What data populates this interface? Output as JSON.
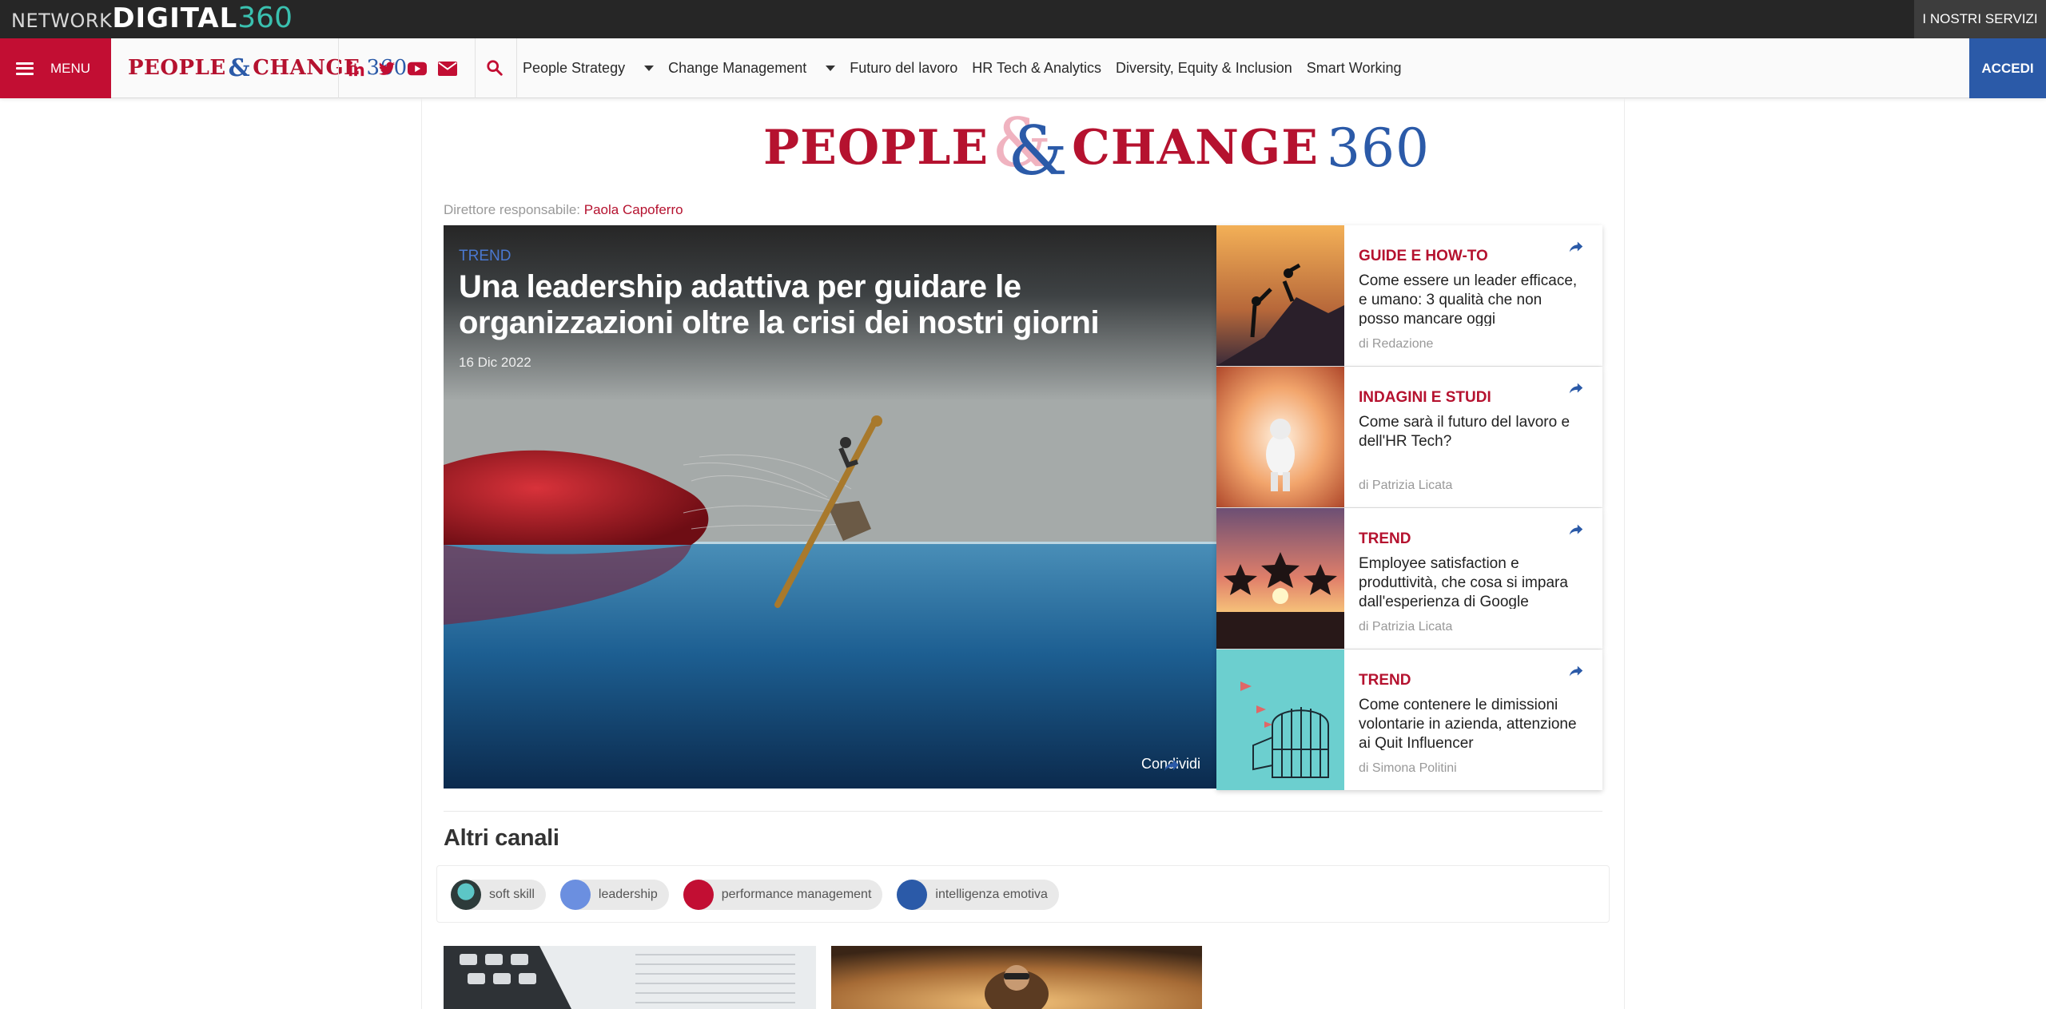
{
  "netbar": {
    "logo": {
      "part1": "NETWORK",
      "part2": "DIGITAL",
      "part3": "360"
    },
    "services_label": "I NOSTRI SERVIZI"
  },
  "nav": {
    "menu_label": "MENU",
    "logo": {
      "part1": "PEOPLE",
      "amp": "&",
      "part2": "CHANGE",
      "num": "360"
    },
    "social_icons": [
      "linkedin-icon",
      "twitter-icon",
      "youtube-icon",
      "mail-icon"
    ],
    "links": [
      {
        "label": "People Strategy",
        "has_dropdown": true
      },
      {
        "label": "Change Management",
        "has_dropdown": true
      },
      {
        "label": "Futuro del lavoro",
        "has_dropdown": false
      },
      {
        "label": "HR Tech & Analytics",
        "has_dropdown": false
      },
      {
        "label": "Diversity, Equity & Inclusion",
        "has_dropdown": false
      },
      {
        "label": "Smart Working",
        "has_dropdown": false
      }
    ],
    "login_label": "ACCEDI"
  },
  "masthead": {
    "logo": {
      "part1": "PEOPLE",
      "amp": "&",
      "part2": "CHANGE",
      "num": "360"
    },
    "director_label": "Direttore responsabile:",
    "director_name": "Paola Capoferro"
  },
  "hero": {
    "tag": "TREND",
    "title": "Una leadership adattiva per guidare le organizzazioni oltre la crisi dei nostri giorni",
    "date": "16 Dic 2022",
    "share_label": "Condividi"
  },
  "side_articles": [
    {
      "category": "GUIDE E HOW-TO",
      "title": "Come essere un leader efficace, e umano: 3 qualità che non posso mancare oggi",
      "author": "di Redazione"
    },
    {
      "category": "INDAGINI E STUDI",
      "title": "Come sarà il futuro del lavoro e dell'HR Tech?",
      "author": "di Patrizia Licata"
    },
    {
      "category": "TREND",
      "title": "Employee satisfaction e produttività, che cosa si impara dall'esperienza di Google",
      "author": "di Patrizia Licata"
    },
    {
      "category": "TREND",
      "title": "Come contenere le dimissioni volontarie in azienda, attenzione ai Quit Influencer",
      "author": "di Simona Politini"
    }
  ],
  "altri_canali": {
    "heading": "Altri canali",
    "chips": [
      {
        "label": "soft skill",
        "color": "#2d3b3a"
      },
      {
        "label": "leadership",
        "color": "#6b8fe0"
      },
      {
        "label": "performance management",
        "color": "#c20e33"
      },
      {
        "label": "intelligenza emotiva",
        "color": "#2b5aa8"
      }
    ]
  },
  "colors": {
    "brand_red": "#c20e33",
    "brand_blue": "#2b5aa8",
    "accent_pink": "#f0b3c0"
  }
}
